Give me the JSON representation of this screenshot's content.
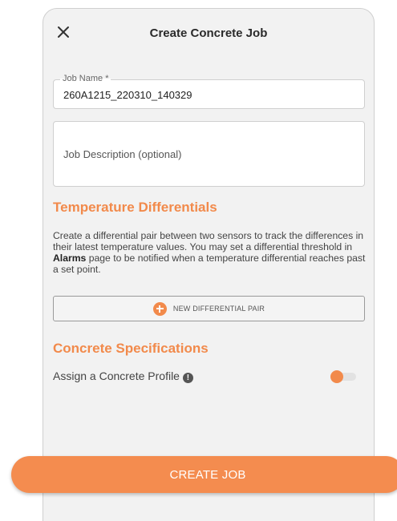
{
  "header": {
    "title": "Create Concrete Job",
    "close_icon": "close-icon"
  },
  "form": {
    "job_name": {
      "label": "Job Name *",
      "value": "260A1215_220310_140329"
    },
    "job_description": {
      "placeholder": "Job Description (optional)",
      "value": ""
    }
  },
  "temperature": {
    "title": "Temperature Differentials",
    "description_before_bold": "Create a differential pair between two sensors to track the differences in their latest temperature values. You may set a differential threshold in ",
    "description_bold": "Alarms",
    "description_after_bold": " page to be notified when a temperature differential reaches past a set point.",
    "new_pair_label": "NEW DIFFERENTIAL PAIR",
    "new_pair_icon": "plus-circle-icon"
  },
  "specifications": {
    "title": "Concrete Specifications",
    "assign_profile_label": "Assign a Concrete Profile",
    "info_icon": "info-icon",
    "info_glyph": "!",
    "assign_profile_enabled": false
  },
  "footer": {
    "create_label": "CREATE JOB"
  },
  "colors": {
    "accent": "#f28a4b",
    "button": "#f48c4f",
    "background": "#f2f2f2",
    "field_border": "#cfcfcf"
  }
}
